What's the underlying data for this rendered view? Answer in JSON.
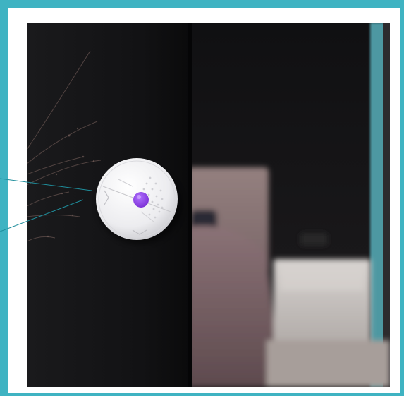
{
  "scene": {
    "subject": "smart-sensor-device",
    "colors": {
      "frame": "#3fb3c2",
      "card": "#ffffff",
      "panel": "#121214",
      "room_dark": "#161618",
      "headboard": "#8a7678",
      "bedding": "#7a6266",
      "nightstand": "#c9c4c0",
      "teal_strip": "#5aa8b2",
      "device_body": "#eeeef0",
      "device_button": "#8b3fe0",
      "leader_line": "#1f8e9c"
    },
    "icons": [
      "sensor-device",
      "purple-button-icon",
      "leader-line"
    ]
  }
}
